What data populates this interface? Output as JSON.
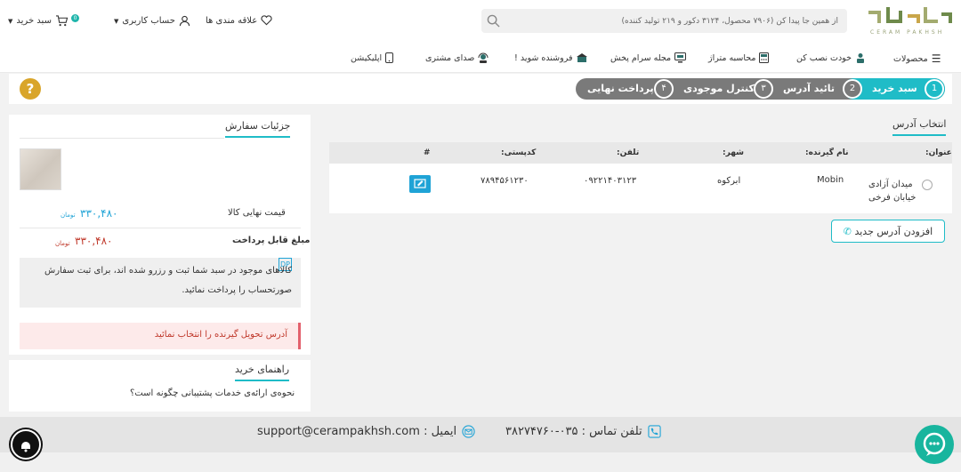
{
  "header": {
    "search_placeholder": "از همین جا پیدا کن (۷۹۰۶ محصول، ۳۱۲۴ دکور و ۲۱۹ تولید کننده)",
    "favorites_label": "علاقه مندی ها",
    "account_label": "حساب کاربری",
    "cart_label": "سبد خرید",
    "cart_count": "0",
    "logo_subtitle": "CERAM PAKHSH"
  },
  "nav": {
    "items": [
      "محصولات",
      "خودت نصب کن",
      "محاسبه متراژ",
      "مجله سرام پخش",
      "فروشنده شوید !",
      "صدای مشتری",
      "اپلیکیشن"
    ]
  },
  "stepper": {
    "steps": [
      {
        "num": "1",
        "label": "سبد خرید"
      },
      {
        "num": "2",
        "label": "تائید آدرس"
      },
      {
        "num": "۳",
        "label": "کنترل موجودی"
      },
      {
        "num": "۴",
        "label": "پرداخت نهایی"
      }
    ],
    "help_symbol": "?"
  },
  "address": {
    "title": "انتخاب آدرس",
    "columns": [
      "عنوان:",
      "نام گیرنده:",
      "شهر:",
      "تلفن:",
      "کدپستی:",
      "#"
    ],
    "rows": [
      {
        "title_line1": "میدان آزادی",
        "title_line2": "خیابان فرخی",
        "recipient": "Mobin",
        "city": "ابرکوه",
        "phone": "۰۹۲۲۱۴۰۳۱۲۳",
        "postal": "۷۸۹۴۵۶۱۲۳۰"
      }
    ],
    "add_button": "افزودن آدرس جدید"
  },
  "order": {
    "title": "جزئیات سفارش",
    "final_price_label": "قیمت نهایی کالا",
    "final_price": "۳۳۰,۴۸۰",
    "payable_label": "مبلغ قابل پرداخت",
    "payable_price": "۳۳۰,۴۸۰",
    "currency": "تومان",
    "note": "کالاهای موجود در سبد شما ثبت و رزرو شده اند، برای ثبت سفارش صورتحساب را پرداخت نمائید.",
    "alert": "آدرس تحویل گیرنده را انتخاب نمائید"
  },
  "guide": {
    "title": "راهنمای خرید",
    "item": "نحوه‌ی ارائه‌ی خدمات پشتیبانی چگونه است؟"
  },
  "footer": {
    "phone": "تلفن تماس : ۰۳۵-۳۸۲۷۴۷۶۰",
    "email": "ایمیل : support@cerampakhsh.com"
  },
  "colors": {
    "accent": "#1fbcc7",
    "step_grey": "#7a7a7a",
    "price_blue": "#1fa3d6",
    "price_red": "#c0392b",
    "help": "#d9a52a",
    "chat": "#18b59e"
  }
}
